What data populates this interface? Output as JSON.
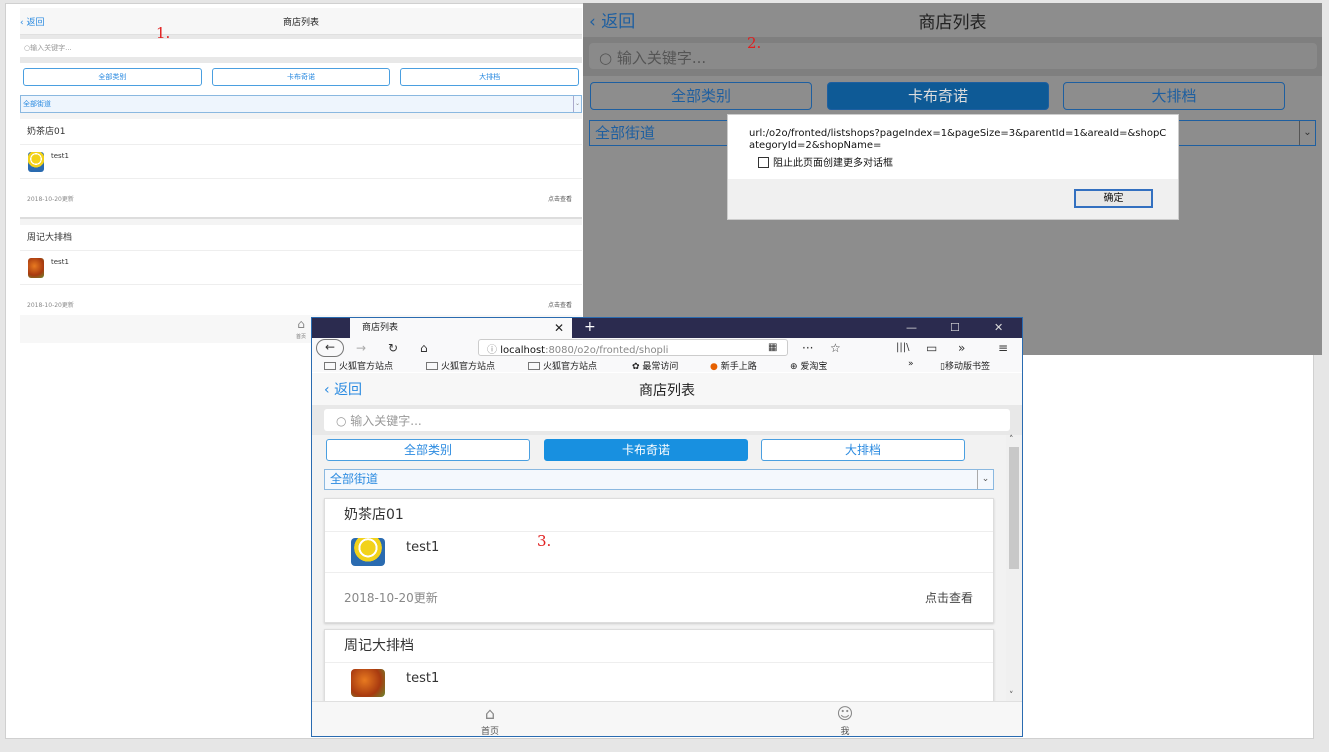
{
  "annotations": [
    "1.",
    "2.",
    "3."
  ],
  "app": {
    "back": "返回",
    "title": "商店列表",
    "search_placeholder": "输入关键字...",
    "categories": [
      "全部类别",
      "卡布奇诺",
      "大排档"
    ],
    "street": "全部街道",
    "shops": [
      {
        "name": "奶茶店01",
        "desc": "test1",
        "date": "2018-10-20更新",
        "view": "点击查看"
      },
      {
        "name": "周记大排档",
        "desc": "test1",
        "date": "2018-10-20更新",
        "view": "点击查看"
      }
    ],
    "footer": {
      "home": "首页",
      "me": "我"
    }
  },
  "dialog": {
    "message": "url:/o2o/fronted/listshops?pageIndex=1&pageSize=3&parentId=1&areaId=&shopCategoryId=2&shopName=",
    "checkbox": "阻止此页面创建更多对话框",
    "ok": "确定"
  },
  "browser": {
    "tab_title": "商店列表",
    "url_host": "localhost",
    "url_rest": ":8080/o2o/fronted/shopli",
    "bookmarks": [
      "火狐官方站点",
      "火狐官方站点",
      "火狐官方站点",
      "最常访问",
      "新手上路",
      "爱淘宝"
    ],
    "mobile_bookmarks": "移动版书签"
  }
}
